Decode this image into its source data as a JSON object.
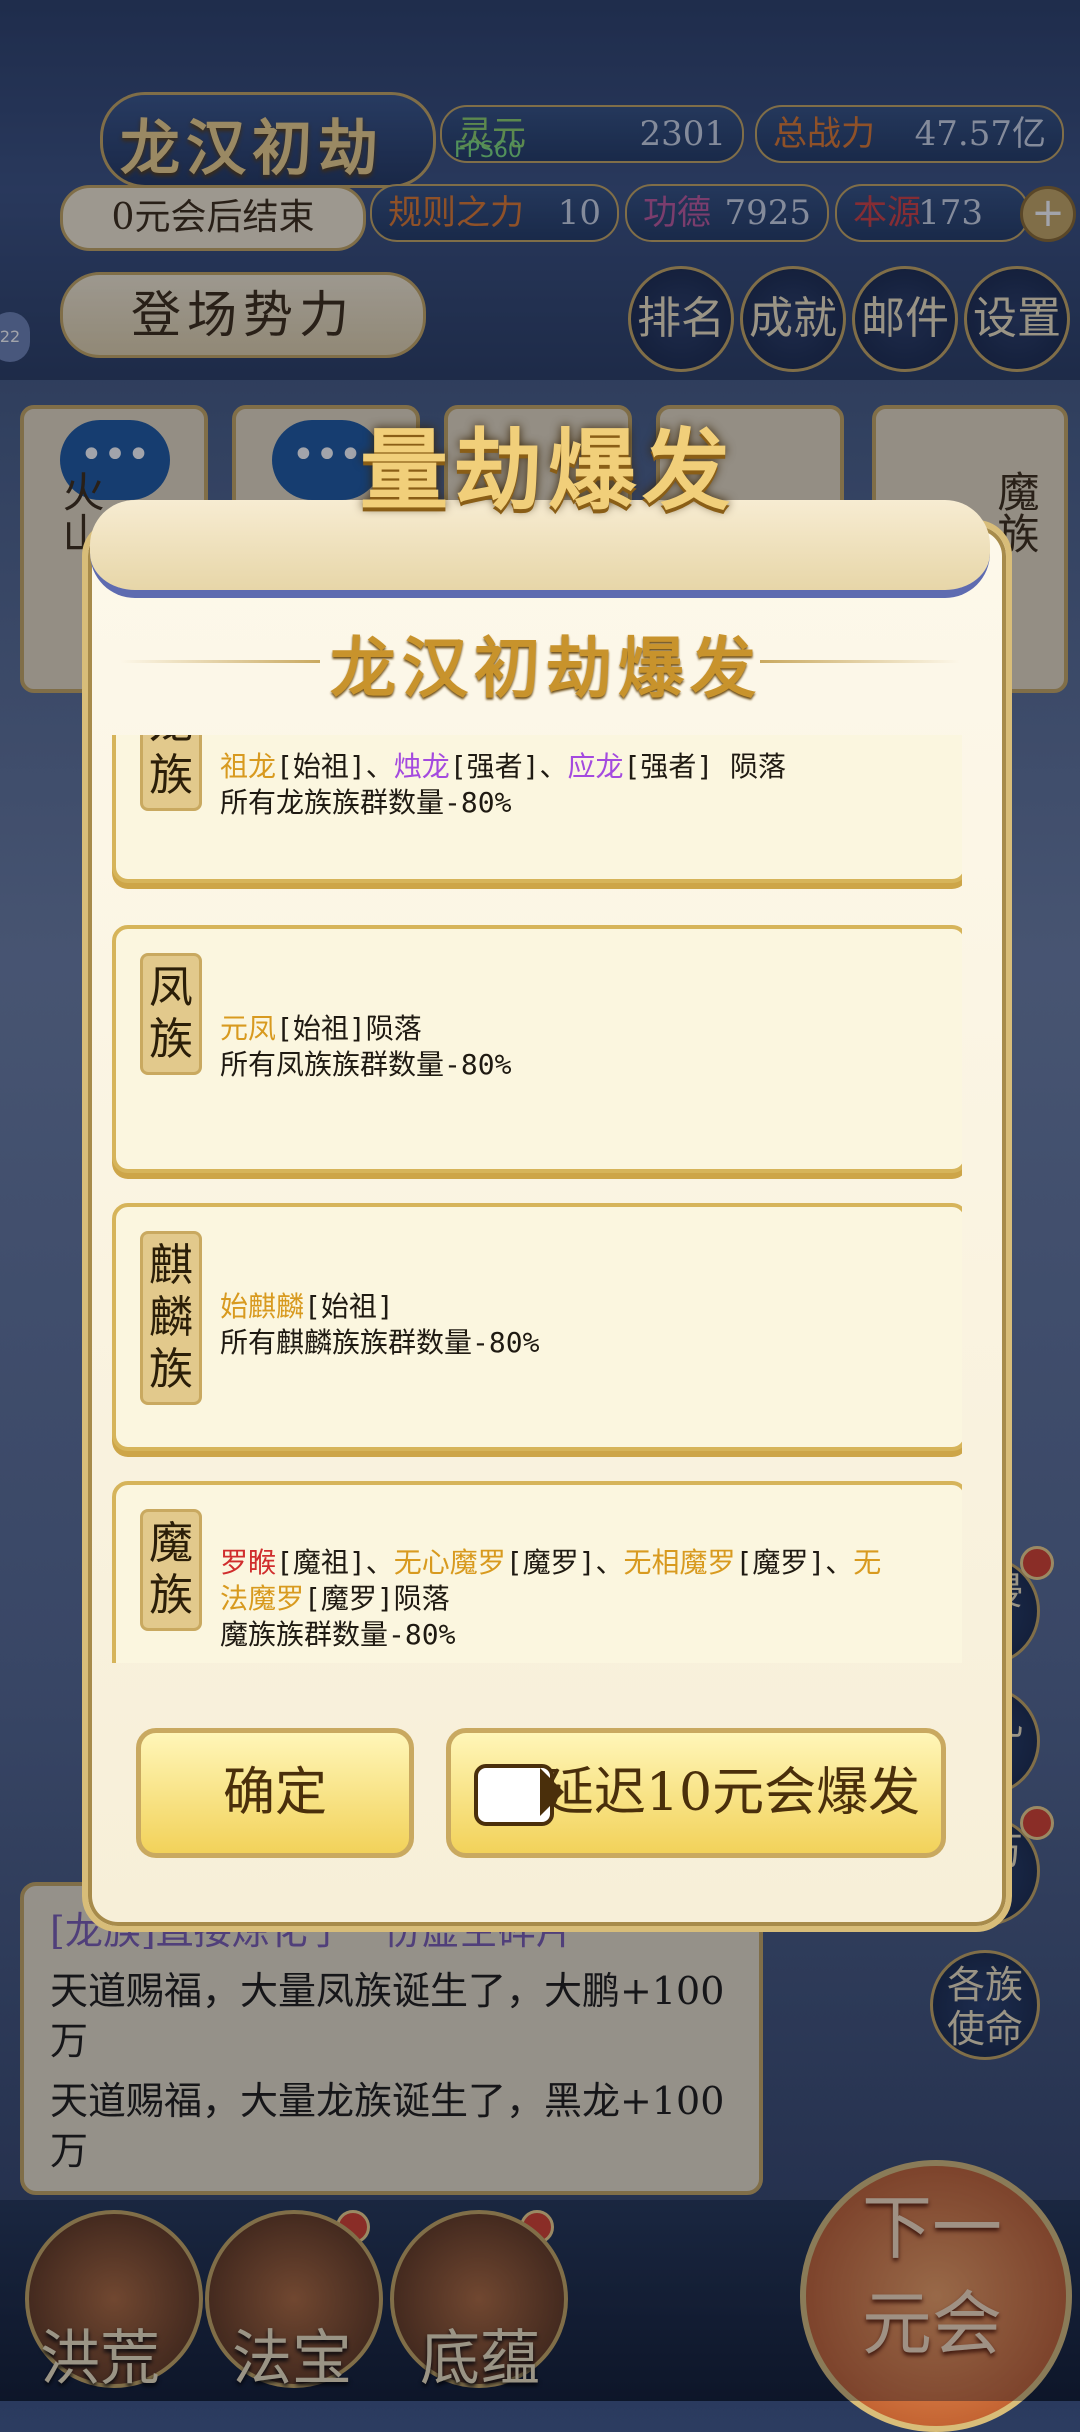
{
  "header": {
    "title": "龙汉初劫",
    "countdown": "0元会后结束",
    "fps": "FPS60",
    "stats": {
      "lingyuan": {
        "label": "灵元",
        "value": "2301"
      },
      "power": {
        "label": "总战力",
        "value": "47.57亿"
      },
      "rule": {
        "label": "规则之力",
        "value": "10"
      },
      "merit": {
        "label": "功德",
        "value": "7925"
      },
      "origin": {
        "label": "本源",
        "value": "173"
      }
    },
    "faction_button": "登场势力",
    "nav": [
      {
        "label": "排名"
      },
      {
        "label": "成就"
      },
      {
        "label": "邮件"
      },
      {
        "label": "设置"
      }
    ],
    "side_badge": "22"
  },
  "background_cards": [
    {
      "text": "火山"
    },
    {
      "text": ""
    },
    {
      "text": ""
    },
    {
      "text": ""
    },
    {
      "text": "魔族"
    }
  ],
  "modal": {
    "headline": "量劫爆发",
    "title": "龙汉初劫爆发",
    "cards": [
      {
        "tab": "龙族",
        "line1_parts": [
          {
            "text": "祖龙",
            "color": "gold"
          },
          {
            "text": "[始祖]、",
            "color": "black"
          },
          {
            "text": "烛龙",
            "color": "purple"
          },
          {
            "text": "[强者]、",
            "color": "black"
          },
          {
            "text": "应龙",
            "color": "purple"
          },
          {
            "text": "[强者] 陨落",
            "color": "black"
          }
        ],
        "line2": "所有龙族族群数量-80%"
      },
      {
        "tab": "凤族",
        "line1_parts": [
          {
            "text": "元凤",
            "color": "gold"
          },
          {
            "text": "[始祖]陨落",
            "color": "black"
          }
        ],
        "line2": "所有凤族族群数量-80%"
      },
      {
        "tab": "麒麟族",
        "line1_parts": [
          {
            "text": "始麒麟",
            "color": "gold"
          },
          {
            "text": "[始祖]",
            "color": "black"
          }
        ],
        "line2": "所有麒麟族族群数量-80%"
      },
      {
        "tab": "魔族",
        "line1_parts": [
          {
            "text": "罗睺",
            "color": "red"
          },
          {
            "text": "[魔祖]、",
            "color": "black"
          },
          {
            "text": "无心魔罗",
            "color": "gold"
          },
          {
            "text": "[魔罗]、",
            "color": "black"
          },
          {
            "text": "无相魔罗",
            "color": "gold"
          },
          {
            "text": "[魔罗]、",
            "color": "black"
          },
          {
            "text": "无",
            "color": "gold"
          }
        ],
        "line1b_parts": [
          {
            "text": "法魔罗",
            "color": "gold"
          },
          {
            "text": "[魔罗]陨落",
            "color": "black"
          }
        ],
        "line2": "魔族族群数量-80%"
      }
    ],
    "confirm_label": "确定",
    "delay_label": "延迟10元会爆发"
  },
  "log": {
    "lines": [
      "[龙族]直接炼化了一份虚空碎片",
      "天道赐福，大量凤族诞生了，大鹏+100万",
      "天道赐福，大量龙族诞生了，黑龙+100万"
    ]
  },
  "side_buttons": [
    {
      "label": "域侵"
    },
    {
      "label": "道儿"
    },
    {
      "label": "身万"
    },
    {
      "label": "各族使命"
    }
  ],
  "bottom_nav": [
    {
      "label": "洪荒"
    },
    {
      "label": "法宝"
    },
    {
      "label": "底蕴"
    }
  ],
  "next_button": "下一元会"
}
